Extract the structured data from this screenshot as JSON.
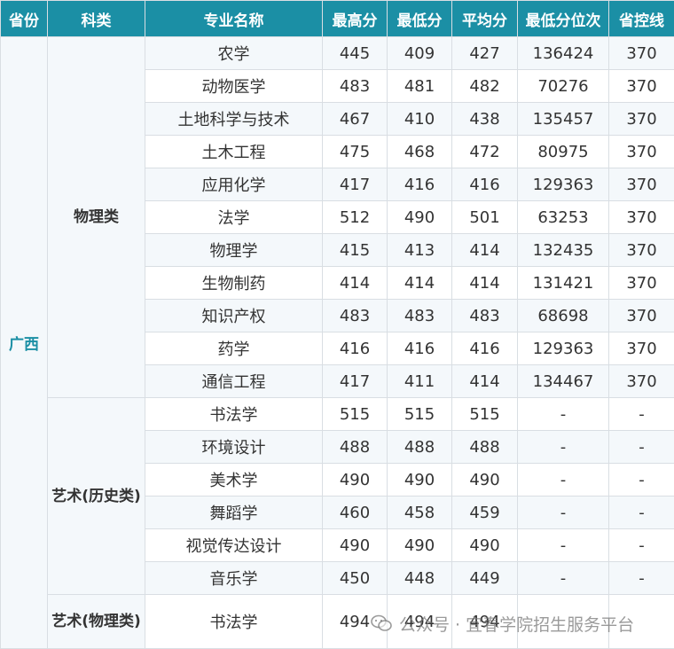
{
  "headers": [
    "省份",
    "科类",
    "专业名称",
    "最高分",
    "最低分",
    "平均分",
    "最低分位次",
    "省控线"
  ],
  "province": "广西",
  "groups": [
    {
      "category": "物理类",
      "rows": [
        [
          "农学",
          "445",
          "409",
          "427",
          "136424",
          "370"
        ],
        [
          "动物医学",
          "483",
          "481",
          "482",
          "70276",
          "370"
        ],
        [
          "土地科学与技术",
          "467",
          "410",
          "438",
          "135457",
          "370"
        ],
        [
          "土木工程",
          "475",
          "468",
          "472",
          "80975",
          "370"
        ],
        [
          "应用化学",
          "417",
          "416",
          "416",
          "129363",
          "370"
        ],
        [
          "法学",
          "512",
          "490",
          "501",
          "63253",
          "370"
        ],
        [
          "物理学",
          "415",
          "413",
          "414",
          "132435",
          "370"
        ],
        [
          "生物制药",
          "414",
          "414",
          "414",
          "131421",
          "370"
        ],
        [
          "知识产权",
          "483",
          "483",
          "483",
          "68698",
          "370"
        ],
        [
          "药学",
          "416",
          "416",
          "416",
          "129363",
          "370"
        ],
        [
          "通信工程",
          "417",
          "411",
          "414",
          "134467",
          "370"
        ]
      ]
    },
    {
      "category": "艺术(历史类)",
      "rows": [
        [
          "书法学",
          "515",
          "515",
          "515",
          "-",
          "-"
        ],
        [
          "环境设计",
          "488",
          "488",
          "488",
          "-",
          "-"
        ],
        [
          "美术学",
          "490",
          "490",
          "490",
          "-",
          "-"
        ],
        [
          "舞蹈学",
          "460",
          "458",
          "459",
          "-",
          "-"
        ],
        [
          "视觉传达设计",
          "490",
          "490",
          "490",
          "-",
          "-"
        ],
        [
          "音乐学",
          "450",
          "448",
          "449",
          "-",
          "-"
        ]
      ]
    },
    {
      "category": "艺术(物理类)",
      "rows": [
        [
          "书法学",
          "494",
          "494",
          "494",
          "",
          ""
        ]
      ]
    }
  ],
  "watermark": "公众号 · 宜春学院招生服务平台"
}
